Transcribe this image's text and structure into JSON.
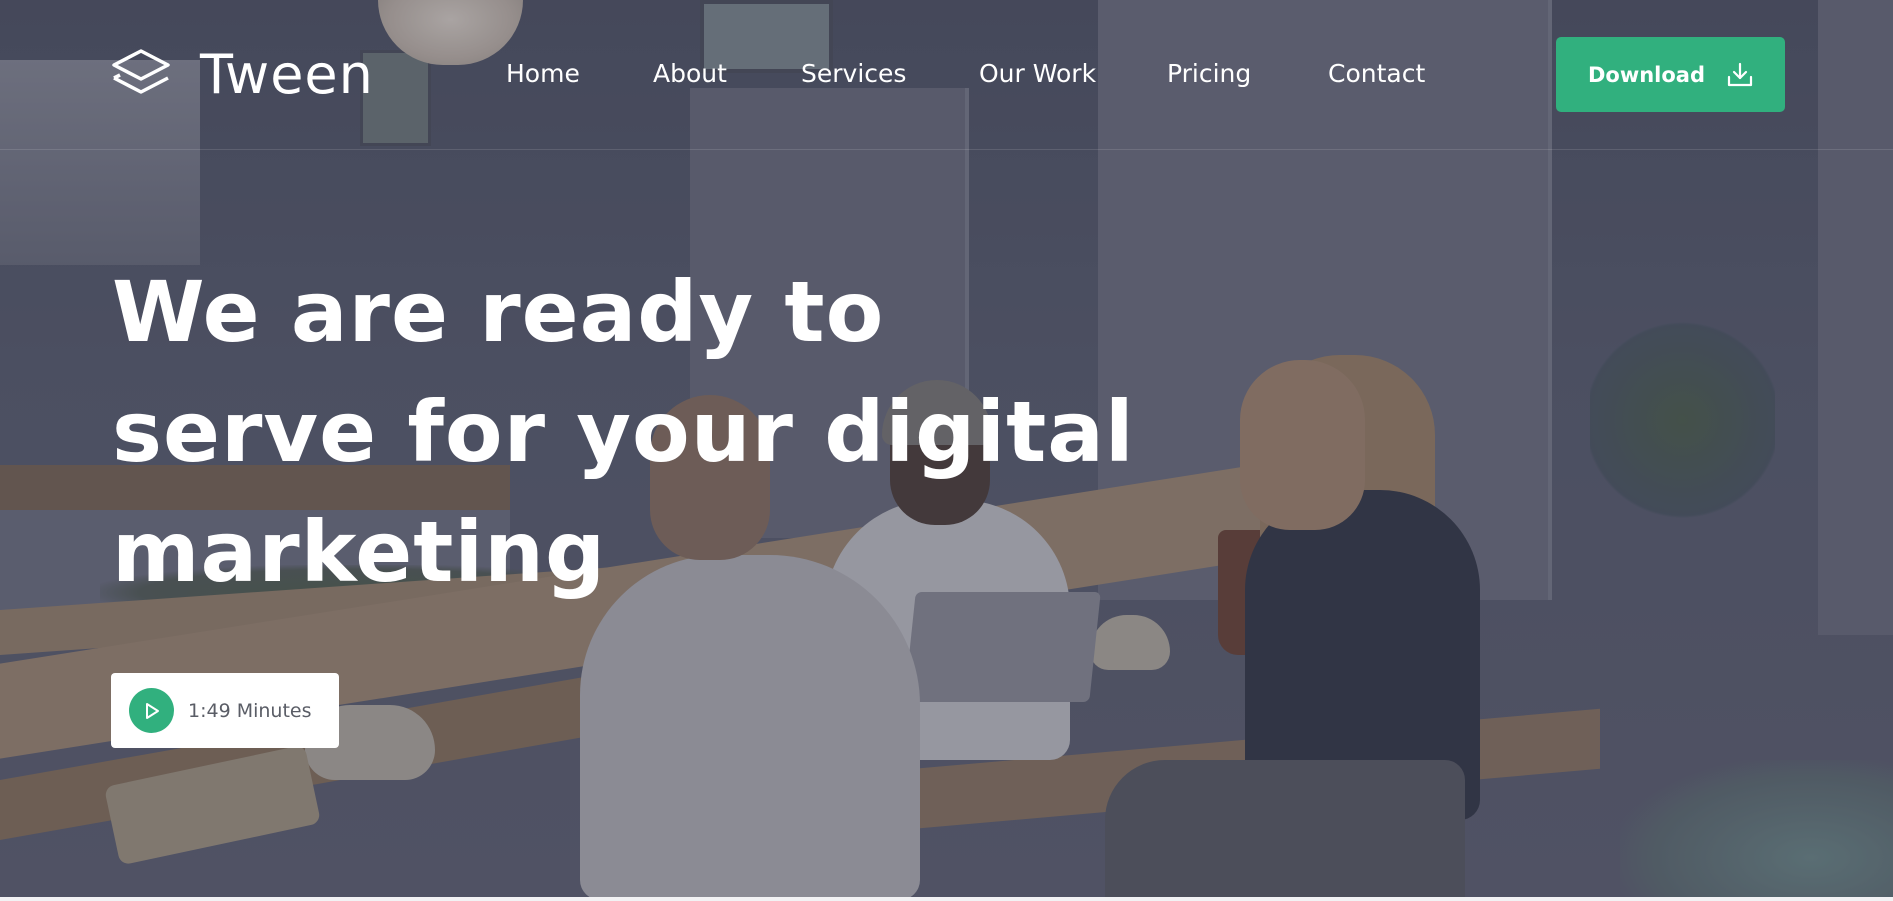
{
  "header": {
    "logo_text": "Tween",
    "nav": [
      {
        "label": "Home"
      },
      {
        "label": "About"
      },
      {
        "label": "Services"
      },
      {
        "label": "Our Work"
      },
      {
        "label": "Pricing"
      },
      {
        "label": "Contact"
      }
    ],
    "download_label": "Download",
    "download_icon": "download-icon"
  },
  "hero": {
    "headline": "We are ready to serve for your digital marketing",
    "video_duration_label": "1:49 Minutes",
    "play_icon": "play-icon",
    "background_description_hidden": ""
  },
  "colors": {
    "accent": "#31b07e",
    "overlay": "#373a4e",
    "text": "#ffffff"
  }
}
